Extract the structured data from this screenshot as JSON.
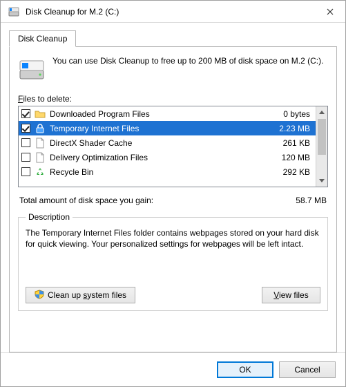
{
  "window": {
    "title": "Disk Cleanup for M.2 (C:)"
  },
  "tab": {
    "label": "Disk Cleanup"
  },
  "intro": "You can use Disk Cleanup to free up to 200 MB of disk space on M.2 (C:).",
  "files_label_pre": "F",
  "files_label_post": "iles to delete:",
  "items": [
    {
      "name": "Downloaded Program Files",
      "size": "0 bytes",
      "checked": true,
      "icon": "folder-icon",
      "selected": false
    },
    {
      "name": "Temporary Internet Files",
      "size": "2.23 MB",
      "checked": true,
      "icon": "lock-icon",
      "selected": true
    },
    {
      "name": "DirectX Shader Cache",
      "size": "261 KB",
      "checked": false,
      "icon": "file-icon",
      "selected": false
    },
    {
      "name": "Delivery Optimization Files",
      "size": "120 MB",
      "checked": false,
      "icon": "file-icon",
      "selected": false
    },
    {
      "name": "Recycle Bin",
      "size": "292 KB",
      "checked": false,
      "icon": "recycle-icon",
      "selected": false
    }
  ],
  "total": {
    "label": "Total amount of disk space you gain:",
    "value": "58.7 MB"
  },
  "description": {
    "legend": "Description",
    "text": "The Temporary Internet Files folder contains webpages stored on your hard disk for quick viewing. Your personalized settings for webpages will be left intact."
  },
  "buttons": {
    "cleanup_pre": "Clean up ",
    "cleanup_ul": "s",
    "cleanup_post": "ystem files",
    "viewfiles_ul": "V",
    "viewfiles_post": "iew files",
    "ok": "OK",
    "cancel": "Cancel"
  }
}
